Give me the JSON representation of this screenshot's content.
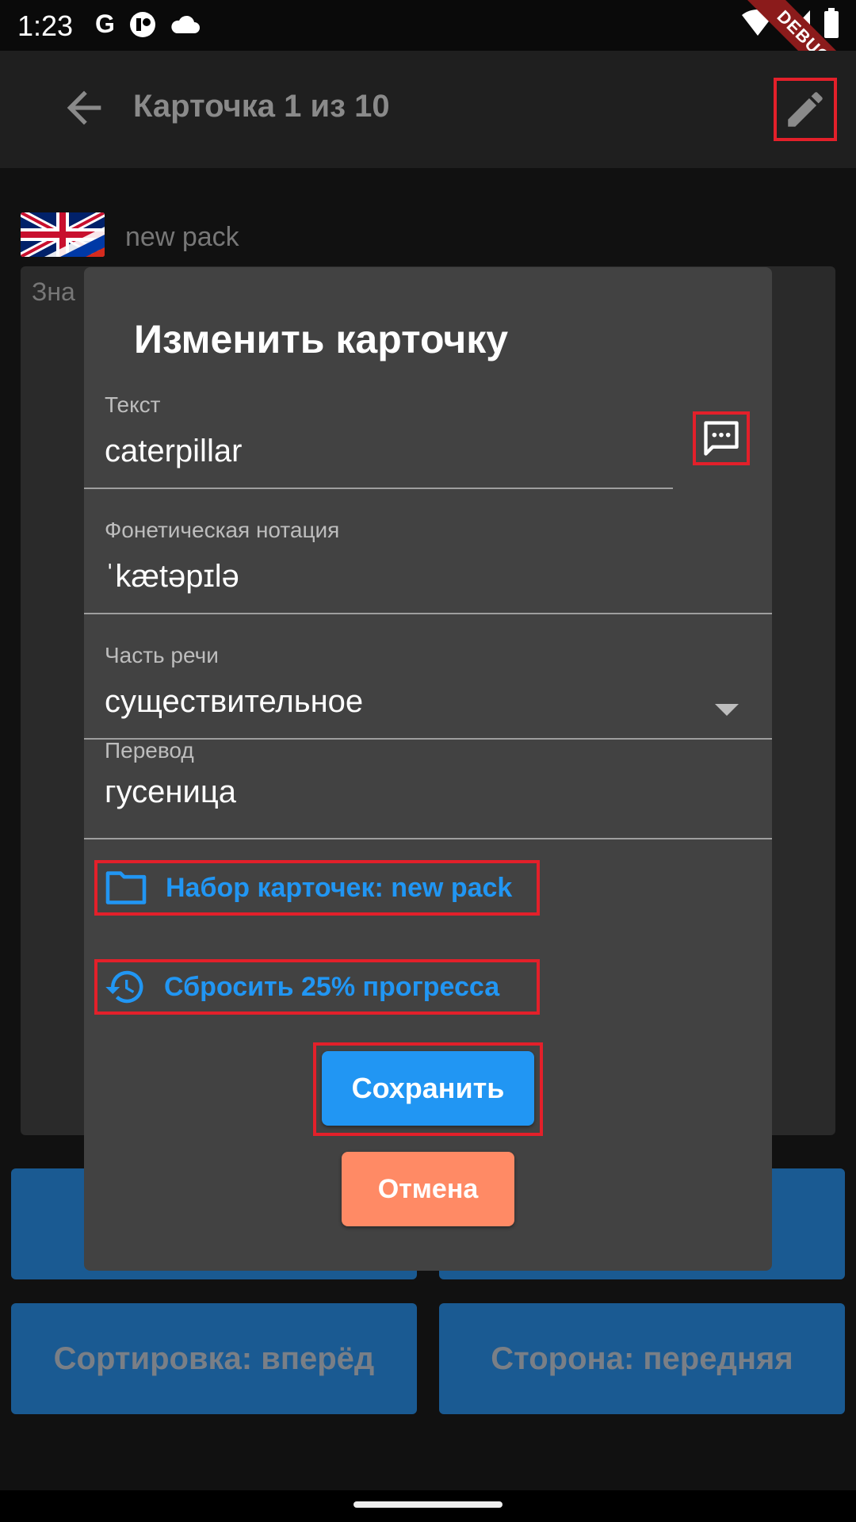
{
  "status_bar": {
    "time": "1:23",
    "left_icons": [
      "google-icon",
      "app-icon",
      "cloud-icon"
    ],
    "right_icons": [
      "wifi-icon",
      "signal-icon",
      "battery-icon"
    ],
    "debug_banner": "DEBUG"
  },
  "app_bar": {
    "title": "Карточка 1 из 10",
    "back_icon": "arrow-back-icon",
    "edit_icon": "pencil-icon"
  },
  "background": {
    "pack_name": "new pack",
    "card_label": "Зна",
    "buttons": [
      {
        "label": ""
      },
      {
        "label": ""
      },
      {
        "label": "Сортировка: вперёд"
      },
      {
        "label": "Сторона: передняя"
      }
    ]
  },
  "dialog": {
    "title": "Изменить карточку",
    "text_field": {
      "label": "Текст",
      "value": "caterpillar"
    },
    "phonetic_field": {
      "label": "Фонетическая нотация",
      "value": "ˈkætəpɪlə"
    },
    "part_of_speech": {
      "label": "Часть речи",
      "value": "существительное"
    },
    "translation_field": {
      "label": "Перевод",
      "value": "гусеница"
    },
    "pack_link": "Набор карточек: new pack",
    "reset_link": "Сбросить 25% прогресса",
    "save_button": "Сохранить",
    "cancel_button": "Отмена"
  },
  "colors": {
    "accent": "#2196f3",
    "cancel": "#ff8a65",
    "dialog_bg": "#424242",
    "highlight": "#e3202a"
  }
}
